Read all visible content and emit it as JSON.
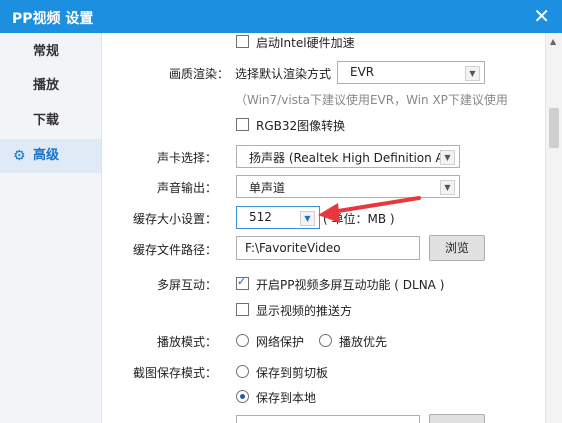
{
  "window": {
    "title": "PP视频 设置",
    "close_icon": "✕"
  },
  "sidebar": {
    "items": [
      {
        "label": "常规"
      },
      {
        "label": "播放"
      },
      {
        "label": "下载"
      },
      {
        "label": "高级",
        "icon": "gear-icon",
        "active": true
      }
    ]
  },
  "settings": {
    "intel_accel": {
      "label": "启动Intel硬件加速",
      "checked": false
    },
    "render": {
      "label": "画质渲染：",
      "prompt": "选择默认渲染方式",
      "value": "EVR",
      "hint": "（Win7/vista下建议使用EVR，Win XP下建议使用"
    },
    "rgb32": {
      "label": "RGB32图像转换",
      "checked": false
    },
    "sound_card": {
      "label": "声卡选择：",
      "value": "扬声器 (Realtek High Definition Au"
    },
    "sound_output": {
      "label": "声音输出：",
      "value": "单声道"
    },
    "cache_size": {
      "label": "缓存大小设置：",
      "value": "512",
      "unit": "( 单位：MB )"
    },
    "cache_path": {
      "label": "缓存文件路径：",
      "value": "F:\\FavoriteVideo",
      "browse": "浏览"
    },
    "multiscreen": {
      "label": "多屏互动：",
      "dlna": {
        "label": "开启PP视频多屏互动功能 ( DLNA )",
        "checked": true
      },
      "show_device": {
        "label": "显示视频的推送方",
        "checked": false
      }
    },
    "play_mode": {
      "label": "播放模式：",
      "options": [
        {
          "label": "网络保护",
          "checked": false
        },
        {
          "label": "播放优先",
          "checked": false
        }
      ]
    },
    "screenshot_mode": {
      "label": "截图保存模式：",
      "options": [
        {
          "label": "保存到剪切板",
          "checked": false
        },
        {
          "label": "保存到本地",
          "checked": true
        }
      ]
    }
  },
  "colors": {
    "accent": "#1d8fe0",
    "annotation_arrow": "#e8383d"
  }
}
